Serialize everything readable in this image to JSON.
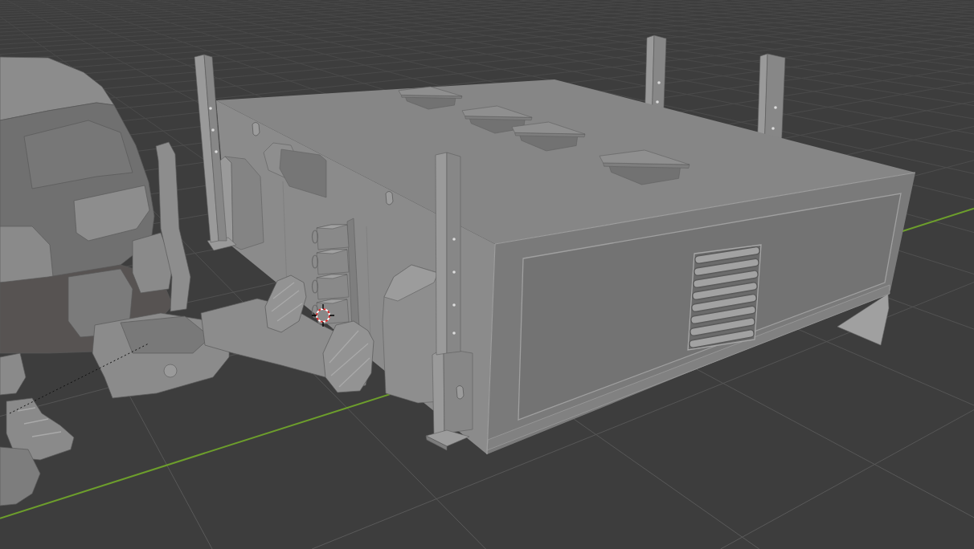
{
  "viewport": {
    "floor_grid": true,
    "axis_line": true,
    "cursor_3d": true
  },
  "objects": [
    {
      "kind": "cargo_box"
    },
    {
      "kind": "machine"
    }
  ]
}
